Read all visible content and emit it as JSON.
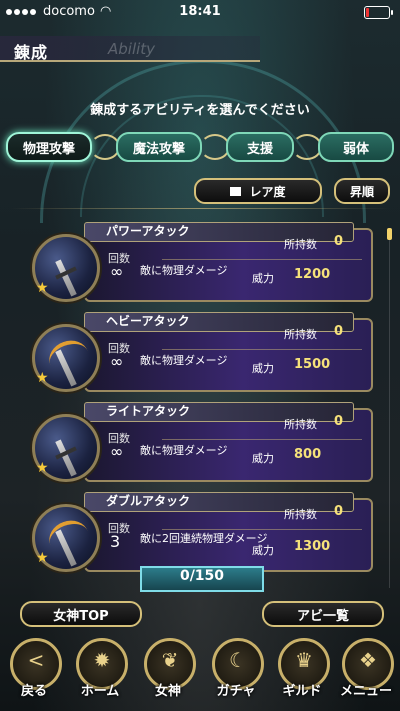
{
  "status_bar": {
    "carrier": "docomo",
    "time": "18:41"
  },
  "header": {
    "title": "錬成",
    "subtitle": "Ability"
  },
  "prompt": "錬成するアビリティを選んでください",
  "tabs": [
    {
      "label": "物理攻撃",
      "active": true
    },
    {
      "label": "魔法攻撃",
      "active": false
    },
    {
      "label": "支援",
      "active": false
    },
    {
      "label": "弱体",
      "active": false
    }
  ],
  "sort": {
    "rarity_label": "レア度",
    "order_label": "昇順"
  },
  "labels": {
    "count": "回数",
    "owned": "所持数",
    "power": "威力"
  },
  "abilities": [
    {
      "name": "パワーアタック",
      "count": "∞",
      "description": "敵に物理ダメージ",
      "owned": "0",
      "power": "1200"
    },
    {
      "name": "ヘビーアタック",
      "count": "∞",
      "description": "敵に物理ダメージ",
      "owned": "0",
      "power": "1500"
    },
    {
      "name": "ライトアタック",
      "count": "∞",
      "description": "敵に物理ダメージ",
      "owned": "0",
      "power": "800"
    },
    {
      "name": "ダブルアタック",
      "count": "3",
      "description": "敵に2回連続物理ダメージ",
      "owned": "0",
      "power": "1300"
    }
  ],
  "counter": "0/150",
  "buttons": {
    "goddess_top": "女神TOP",
    "ability_list": "アビ一覧"
  },
  "nav": [
    {
      "label": "戻る",
      "icon": "back-arrow-icon"
    },
    {
      "label": "ホーム",
      "icon": "home-icon"
    },
    {
      "label": "女神",
      "icon": "wing-icon"
    },
    {
      "label": "ガチャ",
      "icon": "moon-icon"
    },
    {
      "label": "ギルド",
      "icon": "crown-icon"
    },
    {
      "label": "メニュー",
      "icon": "grid-icon"
    }
  ],
  "colors": {
    "accent_gold": "#d5c07a",
    "tab_teal": "#2b6d62",
    "value_yellow": "#f6e27a"
  }
}
